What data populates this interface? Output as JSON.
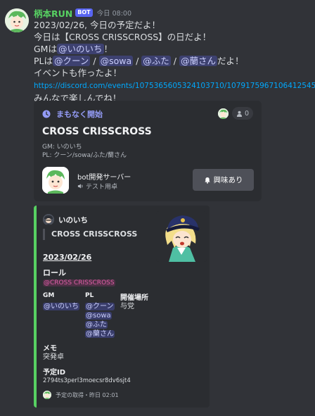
{
  "message": {
    "username": "柄本RUN",
    "bot_tag": "BOT",
    "timestamp": "今日 08:00",
    "lines": [
      "2023/02/26, 今日の予定だよ！",
      "今日は【CROSS CRISSCROSS】の日だよ！"
    ],
    "gm_prefix": "GMは",
    "gm_mention": "@いのいち",
    "gm_suffix": "！",
    "pl_prefix": "PLは",
    "pl_mentions": [
      "@クーン",
      "@sowa",
      "@ふた",
      "@蘭さん"
    ],
    "pl_separator": " / ",
    "pl_suffix": "だよ！",
    "event_line": "イベントも作ったよ！",
    "link": "https://discord.com/events/1075365605324103710/1079175967106412545",
    "last_line": "みんなで楽しんでね！"
  },
  "event": {
    "status": "まもなく開始",
    "interested_count": "0",
    "title": "CROSS CRISSCROSS",
    "desc_line1": "GM: いのいち",
    "desc_line2": "PL: クーン/sowa/ふた/蘭さん",
    "server_name": "bot開発サーバー",
    "location": "テスト用卓",
    "interest_button": "興味あり"
  },
  "embed": {
    "accent_color": "#57d162",
    "author": "いのいち",
    "quote": "CROSS CRISSCROSS",
    "date": "2023/02/26",
    "role_label": "ロール",
    "role_mention": "@CROSS CRISSCROSS",
    "gm_label": "GM",
    "gm_value": "@いのいち",
    "pl_label": "PL",
    "pl_values": [
      "@クーン",
      "@sowa",
      "@ふた",
      "@蘭さん"
    ],
    "venue_label": "開催場所",
    "venue_value": "与党",
    "memo_label": "メモ",
    "memo_value": "突発卓",
    "id_label": "予定ID",
    "id_value": "2794ts3perl3moecsr8dv6sjt4",
    "footer": "予定の取得・昨日 02:01"
  },
  "colors": {
    "background": "#313338",
    "card": "#2b2d31",
    "username": "#57d162",
    "link": "#00a8fc",
    "event_status": "#949cf7"
  }
}
